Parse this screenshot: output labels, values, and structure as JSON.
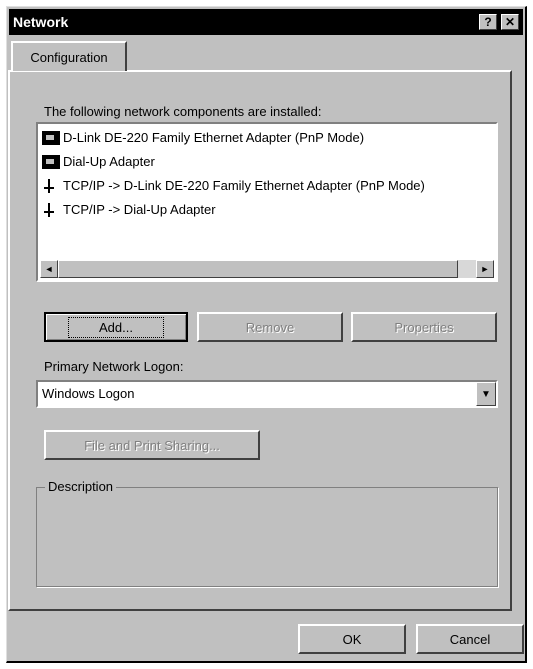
{
  "window": {
    "title": "Network",
    "help_glyph": "?",
    "close_glyph": "✕"
  },
  "tabs": [
    {
      "label": "Configuration"
    }
  ],
  "components": {
    "label": "The following network components are installed:",
    "items": [
      {
        "icon": "network-adapter-icon",
        "label": "D-Link DE-220 Family Ethernet Adapter (PnP Mode)"
      },
      {
        "icon": "network-adapter-icon",
        "label": "Dial-Up Adapter"
      },
      {
        "icon": "protocol-icon",
        "label": "TCP/IP -> D-Link DE-220 Family Ethernet Adapter (PnP Mode)"
      },
      {
        "icon": "protocol-icon",
        "label": "TCP/IP -> Dial-Up Adapter"
      }
    ],
    "scroll_left": "◄",
    "scroll_right": "►"
  },
  "buttons": {
    "add": "Add...",
    "remove": "Remove",
    "properties": "Properties"
  },
  "logon": {
    "label": "Primary Network Logon:",
    "value": "Windows Logon",
    "dropdown_glyph": "▼"
  },
  "sharing": {
    "label": "File and Print Sharing..."
  },
  "description": {
    "label": "Description",
    "text": ""
  },
  "footer": {
    "ok": "OK",
    "cancel": "Cancel"
  }
}
